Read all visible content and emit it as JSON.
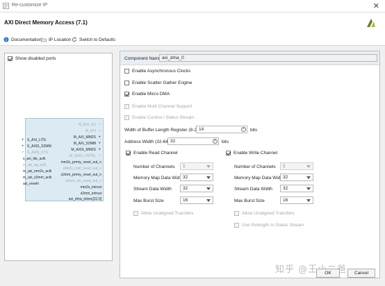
{
  "window": {
    "title": "Re-customize IP"
  },
  "header": {
    "title": "AXI Direct Memory Access (7.1)"
  },
  "toolbar": {
    "documentation": "Documentation",
    "ip_location": "IP Location",
    "switch_defaults": "Switch to Defaults"
  },
  "left": {
    "show_disabled_ports": "Show disabled ports",
    "show_disabled_checked": true,
    "left_ports": [
      "S_AXI_LITE",
      "S_AXIS_S2MM",
      "S_AXIS_STS",
      "s_axi_lite_aclk",
      "m_axi_sg_aclk",
      "m_axi_mm2s_aclk",
      "m_axi_s2mm_aclk",
      "axi_resetn"
    ],
    "right_ports": [
      "M_AXI_SG",
      "M_AXI",
      "M_AXI_MM2S",
      "M_AXI_S2MM",
      "M_AXIS_MM2S",
      "M_AXIS_CNTRL",
      "mm2s_prmry_reset_out_n",
      "mm2s_cntrl_reset_out_n",
      "s2mm_prmry_reset_out_n",
      "s2mm_sts_reset_out_n",
      "mm2s_introut",
      "s2mm_introut",
      "axi_dma_tstvec[31:0]"
    ]
  },
  "config": {
    "component_name_label": "Component Name",
    "component_name_value": "axi_dma_0",
    "async_clocks": "Enable Asynchronous Clocks",
    "scatter_gather": "Enable Scatter Gather Engine",
    "micro_dma": "Enable Micro DMA",
    "multi_channel": "Enable Multi Channel Support",
    "control_status": "Enable Control / Status Stream",
    "buffer_length_label": "Width of Buffer Length Register (8-26)",
    "buffer_length_value": "14",
    "address_width_label": "Address Width (32-64)",
    "address_width_value": "32",
    "bits": "bits",
    "read_channel": {
      "title": "Enable Read Channel",
      "num_channels_label": "Number of Channels",
      "num_channels": "1",
      "mm_width_label": "Memory Map Data Width",
      "mm_width": "32",
      "stream_width_label": "Stream Data Width",
      "stream_width": "32",
      "burst_label": "Max Burst Size",
      "burst": "16",
      "unaligned": "Allow Unaligned Transfers"
    },
    "write_channel": {
      "title": "Enable Write Channel",
      "num_channels_label": "Number of Channels",
      "num_channels": "1",
      "mm_width_label": "Memory Map Data Width",
      "mm_width": "32",
      "stream_width_label": "Stream Data Width",
      "stream_width": "32",
      "burst_label": "Max Burst Size",
      "burst": "16",
      "unaligned": "Allow Unaligned Transfers",
      "relength": "Use Rxlength In Status Stream"
    }
  },
  "footer": {
    "ok": "OK",
    "cancel": "Cancel",
    "watermark": "知乎 @王小二爸"
  },
  "colors": {
    "block_fill": "#dcebf3",
    "header_bg": "#e9eef2"
  }
}
